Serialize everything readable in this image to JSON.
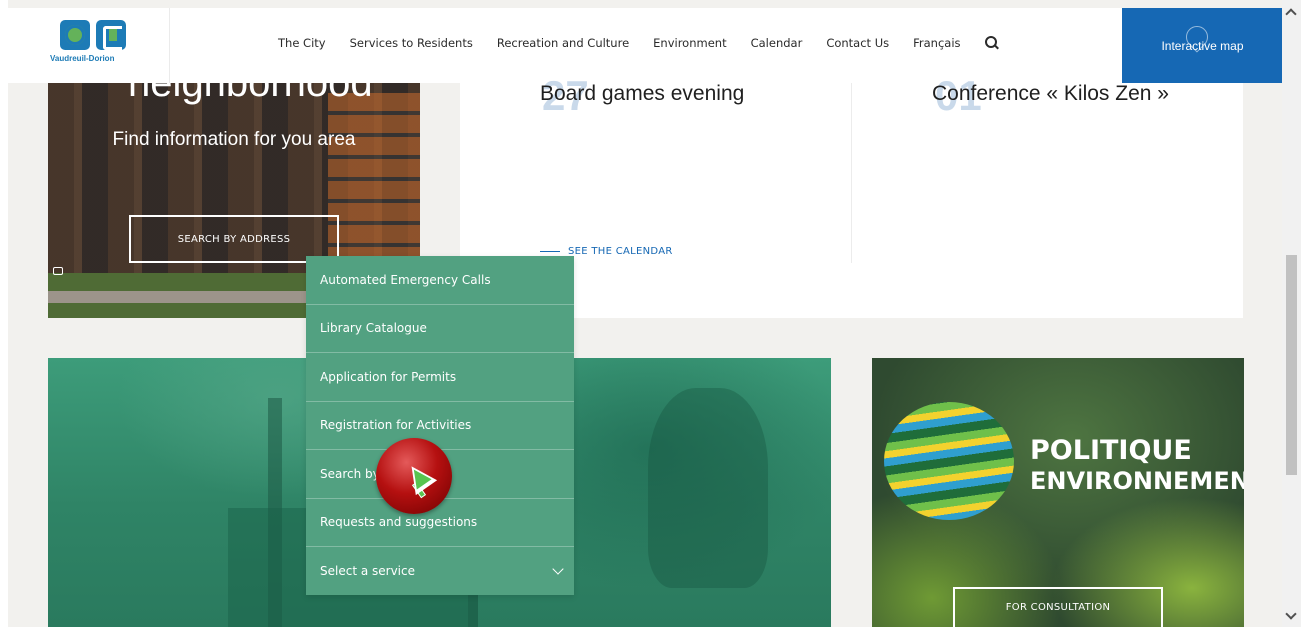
{
  "header": {
    "logo_text": "Vaudreuil-Dorion",
    "nav": [
      "The City",
      "Services to Residents",
      "Recreation and Culture",
      "Environment",
      "Calendar",
      "Contact Us",
      "Français"
    ],
    "interactive_map_label": "Interactive map"
  },
  "neighbourhood": {
    "title": "neighborhood",
    "subtitle": "Find information for you area",
    "button_label": "SEARCH BY ADDRESS"
  },
  "events": {
    "items": [
      {
        "date": "27",
        "title": "Board games evening"
      },
      {
        "date": "01",
        "title": "Conference « Kilos Zen »"
      }
    ],
    "calendar_link": "SEE THE CALENDAR"
  },
  "politique": {
    "title_line1": "POLITIQUE",
    "title_line2": "ENVIRONNEMENTALE",
    "button_label": "FOR CONSULTATION"
  },
  "service_menu": {
    "items": [
      "Automated Emergency Calls",
      "Library Catalogue",
      "Application for Permits",
      "Registration for Activities",
      "Search by themes",
      "Requests and suggestions"
    ],
    "select_label": "Select a service"
  },
  "colors": {
    "brand_blue": "#1668b4",
    "menu_green": "#52a181",
    "link_blue": "#1668b4"
  }
}
